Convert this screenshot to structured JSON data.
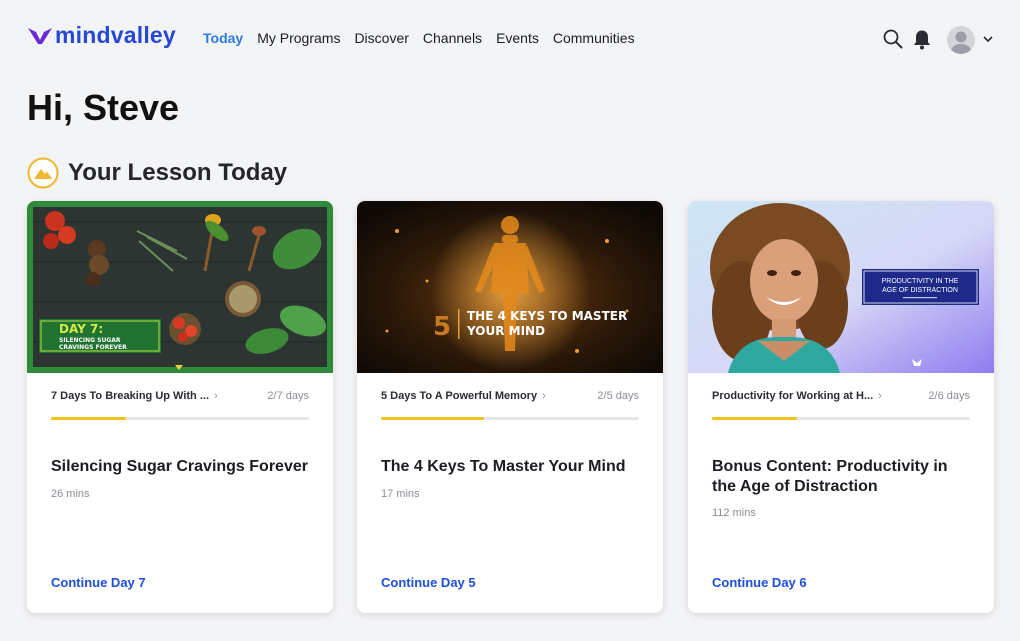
{
  "brand": {
    "name": "mindvalley",
    "color": "#2747d4"
  },
  "nav": {
    "items": [
      "Today",
      "My Programs",
      "Discover",
      "Channels",
      "Events",
      "Communities"
    ],
    "active": "Today"
  },
  "header_icons": {
    "search": "search-icon",
    "notifications": "bell-icon",
    "menu": "chevron-down-icon"
  },
  "greeting": "Hi, Steve",
  "section": {
    "title": "Your Lesson Today",
    "icon": "mountain-icon"
  },
  "cards": [
    {
      "image_text": {
        "line1": "DAY 7:",
        "line2": "SILENCING SUGAR",
        "line3": "CRAVINGS FOREVER"
      },
      "program": "7 Days To Breaking Up With ...",
      "days": "2/7 days",
      "progress": 0.29,
      "title": "Silencing Sugar Cravings Forever",
      "duration": "26 mins",
      "cta": "Continue Day 7"
    },
    {
      "image_text": {
        "number": "5",
        "line1": "THE 4 KEYS TO MASTER",
        "line2": "YOUR MIND"
      },
      "program": "5 Days To A Powerful Memory",
      "days": "2/5 days",
      "progress": 0.4,
      "title": "The 4 Keys To Master Your Mind",
      "duration": "17 mins",
      "cta": "Continue Day 5"
    },
    {
      "image_text": {
        "line1": "PRODUCTIVITY IN THE",
        "line2": "AGE OF DISTRACTION"
      },
      "program": "Productivity for Working at H...",
      "days": "2/6 days",
      "progress": 0.33,
      "title": "Bonus Content: Productivity in the Age of Distraction",
      "duration": "112 mins",
      "cta": "Continue Day 6"
    }
  ],
  "colors": {
    "accent": "#2c7be5",
    "progress": "#f4c11b",
    "cta": "#1d4ed8",
    "background": "#f3f4f6"
  }
}
